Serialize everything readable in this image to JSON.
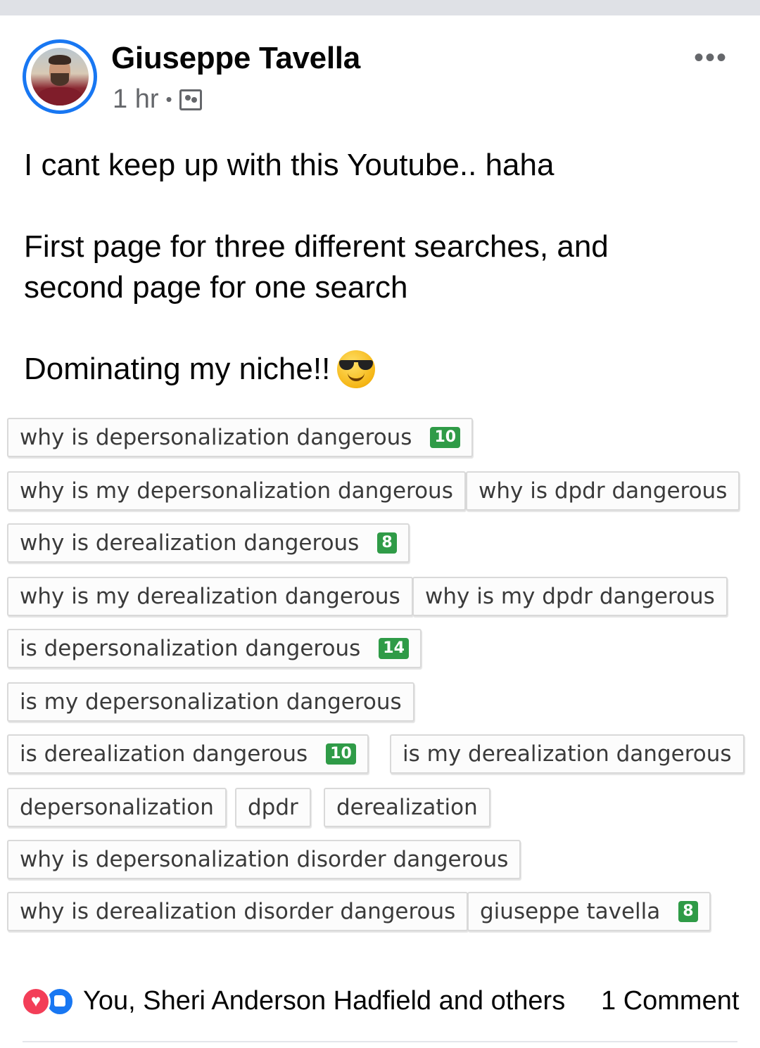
{
  "post": {
    "author": "Giuseppe Tavella",
    "time": "1 hr",
    "separator": "•",
    "audience_icon": "friends-audience-icon",
    "menu_icon": "more-options-icon",
    "text": {
      "line1": "I cant keep up with this Youtube.. haha",
      "line2": "First page for three different searches, and",
      "line3": "second page for one search",
      "line4": "Dominating my niche!!"
    },
    "emoji": "smiling-face-with-sunglasses"
  },
  "tags": [
    {
      "label": "why is depersonalization dangerous",
      "rank": "10"
    },
    {
      "label": "why is my depersonalization dangerous",
      "rank": ""
    },
    {
      "label": "why is dpdr dangerous",
      "rank": ""
    },
    {
      "label": "why is derealization dangerous",
      "rank": "8"
    },
    {
      "label": "why is my derealization dangerous",
      "rank": ""
    },
    {
      "label": "why is my dpdr dangerous",
      "rank": ""
    },
    {
      "label": "is depersonalization dangerous",
      "rank": "14"
    },
    {
      "label": "is my depersonalization dangerous",
      "rank": ""
    },
    {
      "label": "is derealization dangerous",
      "rank": "10"
    },
    {
      "label": "is my derealization dangerous",
      "rank": ""
    },
    {
      "label": "depersonalization",
      "rank": ""
    },
    {
      "label": "dpdr",
      "rank": ""
    },
    {
      "label": "derealization",
      "rank": ""
    },
    {
      "label": "why is depersonalization disorder dangerous",
      "rank": ""
    },
    {
      "label": "why is derealization disorder dangerous",
      "rank": ""
    },
    {
      "label": "giuseppe tavella",
      "rank": "8"
    }
  ],
  "footer": {
    "reactions_text": "You, Sheri Anderson Hadfield and others",
    "comments": "1 Comment"
  },
  "colors": {
    "badge": "#2f9b47",
    "link_blue": "#1877f2",
    "love": "#f33e58",
    "secondary_text": "#65676b"
  }
}
